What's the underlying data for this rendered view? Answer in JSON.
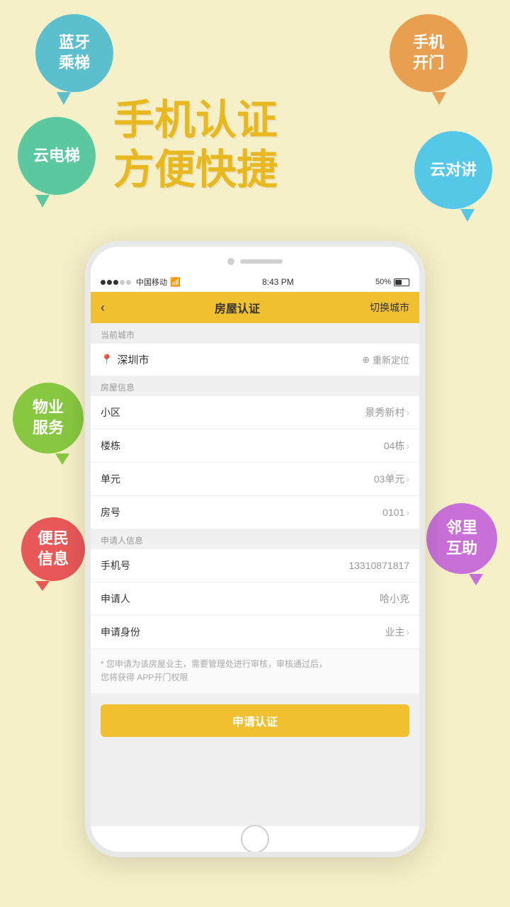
{
  "background": {
    "color": "#f5f0c8"
  },
  "bubbles": {
    "bluetooth": {
      "text": "蓝牙\n乘梯",
      "color": "#5bbfcd"
    },
    "phone_door": {
      "text": "手机\n开门",
      "color": "#e8a050"
    },
    "cloud_elevator": {
      "text": "云电梯",
      "color": "#5bc8a0"
    },
    "cloud_talk": {
      "text": "云对讲",
      "color": "#55c8e8"
    },
    "property": {
      "text": "物业\n服务",
      "color": "#88c840"
    },
    "info": {
      "text": "便民\n信息",
      "color": "#e85858"
    },
    "neighbor": {
      "text": "邻里\n互助",
      "color": "#c870d8"
    }
  },
  "hero": {
    "line1": "手机认证",
    "line2": "方便快捷"
  },
  "phone": {
    "status_bar": {
      "carrier": "中国移动",
      "wifi": "WiFi",
      "time": "8:43 PM",
      "battery": "50%"
    },
    "nav": {
      "back": "‹",
      "title": "房屋认证",
      "action": "切换城市"
    },
    "current_city_section": {
      "header": "当前城市",
      "city": "深圳市",
      "relocate_label": "重新定位"
    },
    "house_info_section": {
      "header": "房屋信息",
      "rows": [
        {
          "label": "小区",
          "value": "景秀新村",
          "arrow": true
        },
        {
          "label": "楼栋",
          "value": "04栋",
          "arrow": true
        },
        {
          "label": "单元",
          "value": "03单元",
          "arrow": true
        },
        {
          "label": "房号",
          "value": "0101",
          "arrow": true
        }
      ]
    },
    "applicant_section": {
      "header": "申请人信息",
      "rows": [
        {
          "label": "手机号",
          "value": "13310871817",
          "arrow": false
        },
        {
          "label": "申请人",
          "value": "哈小克",
          "arrow": false
        },
        {
          "label": "申请身份",
          "value": "业主",
          "arrow": true
        }
      ]
    },
    "note": "* 您申请为该房屋业主，需要管理处进行审核，审核通过后，\n   您将获得   APP开门权限",
    "submit_button": "申请认证"
  }
}
